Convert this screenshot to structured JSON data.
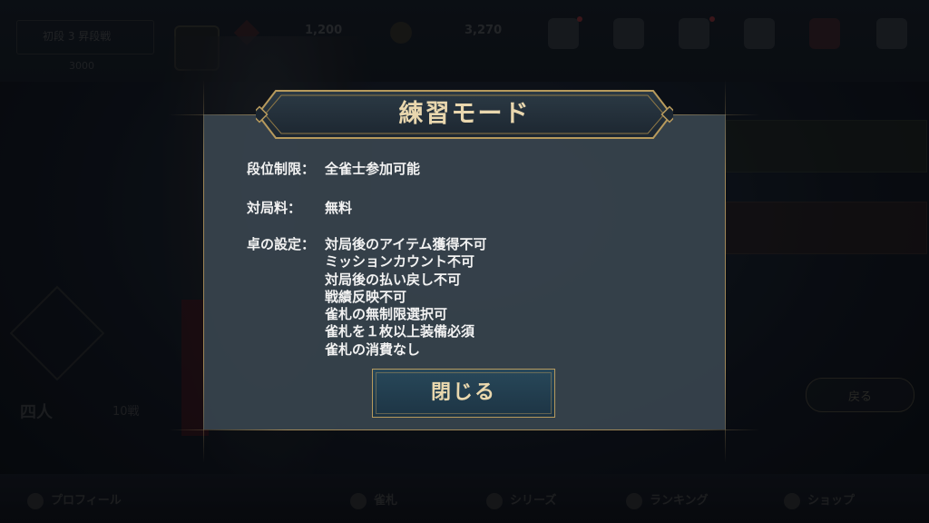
{
  "background": {
    "rank_label": "初段 3 昇段戦",
    "player_level": "3000",
    "gem_amount": "1,200",
    "coin_amount": "3,270",
    "players_label": "四人",
    "count_label": "10戦",
    "back_label": "戻る",
    "nav": [
      "プロフィール",
      "雀札",
      "シリーズ",
      "ランキング",
      "ショップ"
    ]
  },
  "modal": {
    "title": "練習モード",
    "rank_limit_label": "段位制限：",
    "rank_limit_value": "全雀士参加可能",
    "fee_label": "対局料：",
    "fee_value": "無料",
    "table_settings_label": "卓の設定：",
    "table_settings": [
      "対局後のアイテム獲得不可",
      "ミッションカウント不可",
      "対局後の払い戻し不可",
      "戦績反映不可",
      "雀札の無制限選択可",
      "雀札を１枚以上装備必須",
      "雀札の消費なし"
    ],
    "close_label": "閉じる"
  },
  "colors": {
    "accent_gold": "#e9d7ae",
    "frame_gold": "#b79a5d",
    "modal_bg": "#38444e",
    "button_bg": "#28485a"
  }
}
